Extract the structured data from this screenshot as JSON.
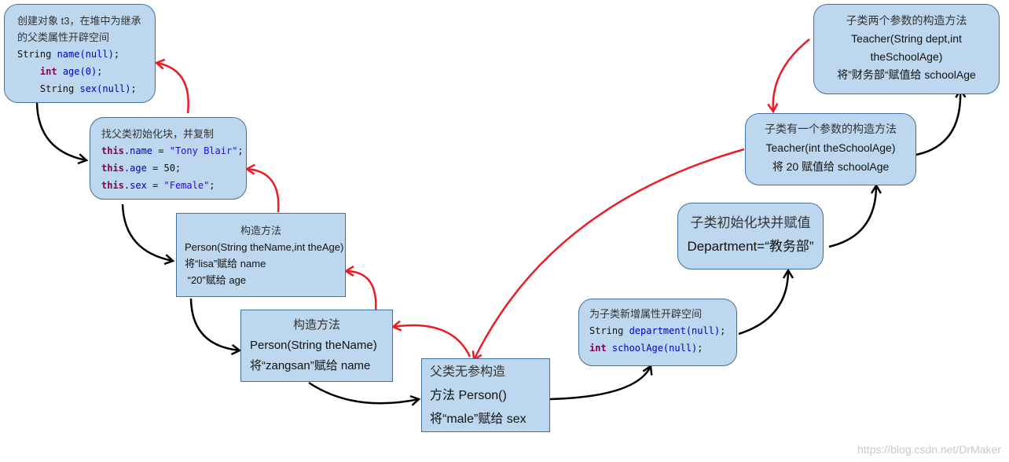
{
  "boxes": [
    {
      "id": "parent-field-space",
      "lines": [
        [
          {
            "t": "创建对象 t3，在堆中为继承",
            "c": "zh"
          }
        ],
        [
          {
            "t": "的父类属性开辟空间",
            "c": "zh"
          }
        ],
        [
          {
            "t": "String ",
            "c": "mono"
          },
          {
            "t": "name(null)",
            "c": "mono id"
          },
          {
            "t": ";",
            "c": "mono"
          }
        ],
        [
          {
            "t": "    ",
            "c": "mono"
          },
          {
            "t": "int",
            "c": "mono kw"
          },
          {
            "t": " age(0)",
            "c": "mono id"
          },
          {
            "t": ";",
            "c": "mono"
          }
        ],
        [
          {
            "t": "    String ",
            "c": "mono"
          },
          {
            "t": "sex(null)",
            "c": "mono id"
          },
          {
            "t": ";",
            "c": "mono"
          }
        ]
      ]
    },
    {
      "id": "parent-init-block",
      "lines": [
        [
          {
            "t": "找父类初始化块，并复制",
            "c": "zh"
          }
        ],
        [
          {
            "t": "this",
            "c": "mono kw"
          },
          {
            "t": ".name",
            "c": "mono id"
          },
          {
            "t": " = ",
            "c": "mono"
          },
          {
            "t": "\"Tony Blair\"",
            "c": "mono str"
          },
          {
            "t": ";",
            "c": "mono"
          }
        ],
        [
          {
            "t": "this",
            "c": "mono kw"
          },
          {
            "t": ".age",
            "c": "mono id"
          },
          {
            "t": " = 50;",
            "c": "mono"
          }
        ],
        [
          {
            "t": "this",
            "c": "mono kw"
          },
          {
            "t": ".sex",
            "c": "mono id"
          },
          {
            "t": " = ",
            "c": "mono"
          },
          {
            "t": "\"Female\"",
            "c": "mono str"
          },
          {
            "t": ";",
            "c": "mono"
          }
        ]
      ]
    },
    {
      "id": "person-two-arg-constructor",
      "lines": [
        [
          {
            "t": "构造方法",
            "c": "zh center"
          }
        ],
        [
          {
            "t": "Person(String theName,int theAge)",
            "c": ""
          }
        ],
        [
          {
            "t": "将“lisa”赋给 name",
            "c": ""
          }
        ],
        [
          {
            "t": " “20”赋给 age",
            "c": ""
          }
        ]
      ]
    },
    {
      "id": "person-one-arg-constructor",
      "lines": [
        [
          {
            "t": "构造方法",
            "c": "zh center"
          }
        ],
        [
          {
            "t": "Person(String theName)",
            "c": ""
          }
        ],
        [
          {
            "t": "将“zangsan”赋给 name",
            "c": ""
          }
        ]
      ]
    },
    {
      "id": "person-no-arg-constructor",
      "lines": [
        [
          {
            "t": "父类无参构造",
            "c": "zh"
          }
        ],
        [
          {
            "t": "方法 Person()",
            "c": ""
          }
        ],
        [
          {
            "t": "将“male”赋给 sex",
            "c": ""
          }
        ]
      ]
    },
    {
      "id": "child-field-space",
      "lines": [
        [
          {
            "t": "为子类新增属性开辟空间",
            "c": "zh"
          }
        ],
        [
          {
            "t": "String ",
            "c": "mono"
          },
          {
            "t": "department(null)",
            "c": "mono id"
          },
          {
            "t": ";",
            "c": "mono"
          }
        ],
        [
          {
            "t": "int",
            "c": "mono kw"
          },
          {
            "t": " schoolAge(null)",
            "c": "mono id"
          },
          {
            "t": ";",
            "c": "mono"
          }
        ]
      ]
    },
    {
      "id": "child-init-block",
      "lines": [
        [
          {
            "t": "子类初始化块并赋值",
            "c": "zh center"
          }
        ],
        [
          {
            "t": "Department=“教务部”",
            "c": "center"
          }
        ]
      ]
    },
    {
      "id": "teacher-one-arg-constructor",
      "lines": [
        [
          {
            "t": "子类有一个参数的构造方法",
            "c": "zh center"
          }
        ],
        [
          {
            "t": "Teacher(int theSchoolAge)",
            "c": "center"
          }
        ],
        [
          {
            "t": "将 20 赋值给 schoolAge",
            "c": "center"
          }
        ]
      ]
    },
    {
      "id": "teacher-two-arg-constructor",
      "lines": [
        [
          {
            "t": "子类两个参数的构造方法",
            "c": "zh center"
          }
        ],
        [
          {
            "t": "Teacher(String dept,int",
            "c": "center"
          }
        ],
        [
          {
            "t": "theSchoolAge)",
            "c": "center"
          }
        ],
        [
          {
            "t": "将”财务部“赋值给 schoolAge",
            "c": "center"
          }
        ]
      ]
    }
  ],
  "colors": {
    "box_fill": "#bdd7ee",
    "box_border": "#41719c",
    "flow_arrow": "#000000",
    "return_arrow": "#ed1c24"
  },
  "watermark": "https://blog.csdn.net/DrMaker"
}
